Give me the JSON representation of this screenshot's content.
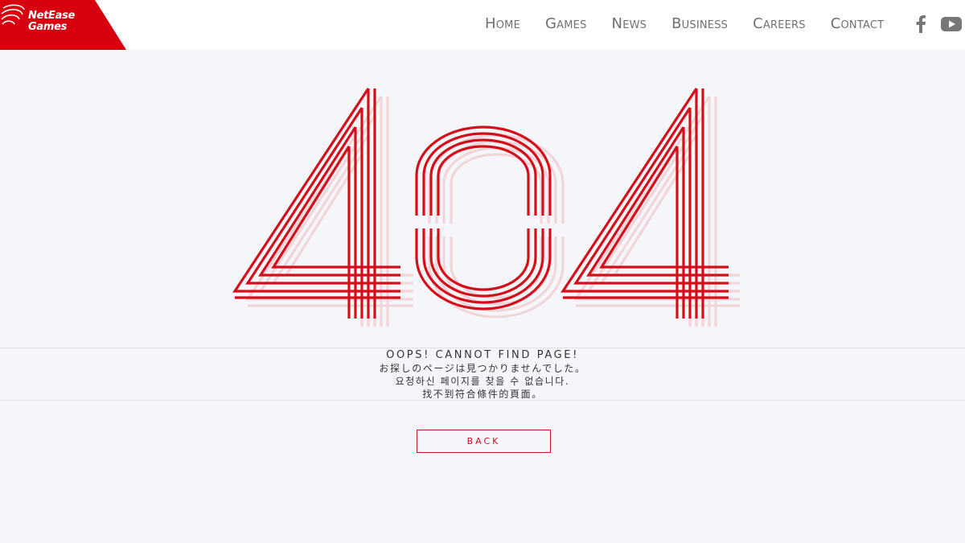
{
  "brand": {
    "line1": "NetEase",
    "line2": "Games",
    "color": "#c9131e"
  },
  "nav": {
    "items": [
      "Home",
      "Games",
      "News",
      "Business",
      "Careers",
      "Contact"
    ]
  },
  "social": {
    "facebook_icon": "facebook-icon",
    "youtube_icon": "youtube-icon"
  },
  "error": {
    "code": "404",
    "message_en": "OOPS! CANNOT FIND PAGE!",
    "message_ja": "お探しのページは見つかりませんでした。",
    "message_ko": "요청하신 페이지를 찾을 수 없습니다.",
    "message_zh": "找不到符合條件的頁面。"
  },
  "back_button": {
    "label": "BACK"
  }
}
